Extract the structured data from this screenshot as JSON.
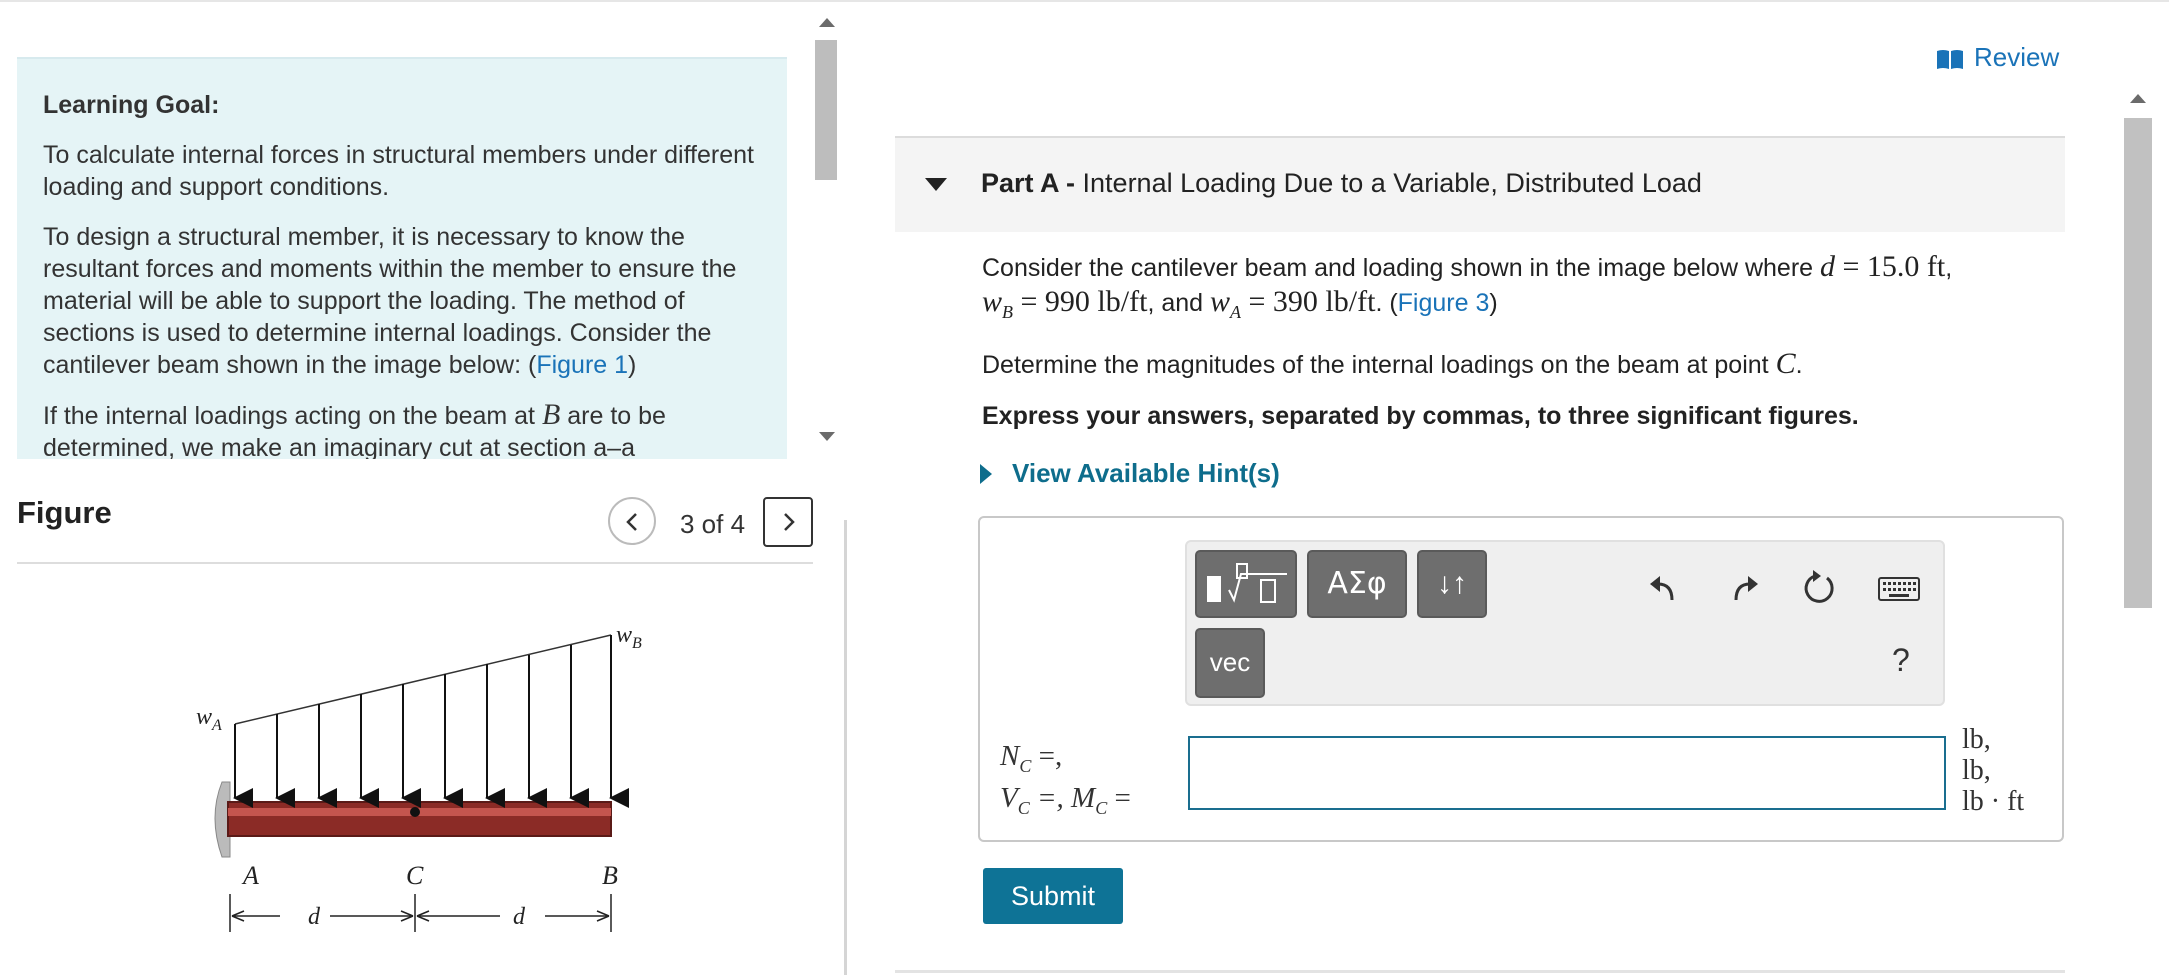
{
  "left": {
    "goal_title": "Learning Goal:",
    "goal_p1": "To calculate internal forces in structural members under different loading and support conditions.",
    "goal_p2_text": "To design a structural member, it is necessary to know the resultant forces and moments within the member to ensure the material will be able to support the loading. The method of sections is used to determine internal loadings. Consider the cantilever beam shown in the image below: (",
    "goal_p2_link": "Figure 1",
    "goal_p2_end": ")",
    "goal_p3_text": "If the internal loadings acting on the beam at",
    "goal_p3_var": "B",
    "goal_p3_end": "are to be",
    "goal_p4_partial": "determined, we make an imaginary cut at section a–a"
  },
  "figure": {
    "title": "Figure",
    "counter": "3 of 4",
    "labels": {
      "wA": "w",
      "wA_sub": "A",
      "wB": "w",
      "wB_sub": "B",
      "A": "A",
      "C": "C",
      "B": "B",
      "d1": "d",
      "d2": "d"
    }
  },
  "header": {
    "review_label": "Review"
  },
  "part": {
    "label": "Part A -",
    "title": "Internal Loading Due to a Variable, Distributed Load"
  },
  "question": {
    "q1_a": "Consider the cantilever beam and loading shown in the image below where",
    "q1_d": "d = 15.0 ft",
    "q1_b": ",",
    "q1_wb": "w",
    "q1_wb_sub": "B",
    "q1_wb_val": " = 990 lb/ft",
    "q1_c": ", and",
    "q1_wa": "w",
    "q1_wa_sub": "A",
    "q1_wa_val": " = 390 lb/ft",
    "q1_d2": ". (",
    "q1_link": "Figure 3",
    "q1_e": ")",
    "q2_text": "Determine the magnitudes of the internal loadings on the beam at point",
    "q2_var": "C",
    "q2_end": ".",
    "q3_text": "Express your answers, separated by commas, to three significant figures."
  },
  "hints": {
    "label": "View Available Hint(s)"
  },
  "toolbar": {
    "greek_label": "ΑΣφ",
    "arrows_label": "↓↑",
    "vec_label": "vec",
    "help_label": "?"
  },
  "answer": {
    "label_line1": "N",
    "label_line1_sub": "C",
    "label_line1_end": " =,",
    "label_line2_a": "V",
    "label_line2_a_sub": "C",
    "label_line2_mid": " =, M",
    "label_line2_b_sub": "C",
    "label_line2_end": " =",
    "input_value": "",
    "unit1": "lb,",
    "unit2": "lb,",
    "unit3": "lb · ft"
  },
  "submit": {
    "label": "Submit"
  },
  "colors": {
    "link": "#1a73b8",
    "hint": "#0e6d8c",
    "submit_bg": "#0e7396",
    "goal_bg": "#e5f4f6",
    "beam": "#8b2b26"
  }
}
